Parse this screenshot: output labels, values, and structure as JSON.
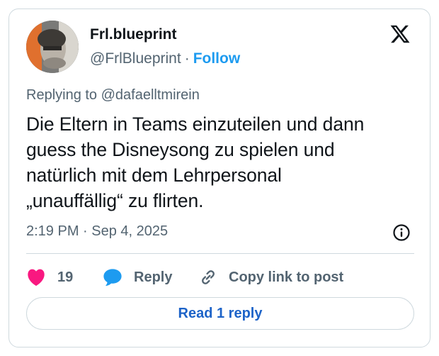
{
  "author": {
    "display_name": "Frl.blueprint",
    "handle": "@FrlBlueprint",
    "separator": "·",
    "follow_label": "Follow"
  },
  "tweet": {
    "replying_to": "Replying to @dafaelltmirein",
    "text_lines": [
      "Die Eltern in Teams einzuteilen und dann",
      "guess the Disneysong zu spielen und",
      "natürlich mit dem Lehrpersonal",
      "„unauffällig“ zu flirten."
    ],
    "timestamp": "2:19 PM · Sep 4, 2025"
  },
  "actions": {
    "like_count": "19",
    "reply_label": "Reply",
    "copy_link_label": "Copy link to post"
  },
  "footer": {
    "read_replies_label": "Read 1 reply"
  },
  "icons": {
    "brand": "x-logo-icon",
    "like": "heart-icon",
    "reply": "speech-bubble-icon",
    "copy": "link-icon",
    "info": "info-icon"
  },
  "colors": {
    "like": "#f91880",
    "reply": "#1d9bf0",
    "link": "#1d9bf0",
    "read_replies_text": "#1d63c8",
    "border": "#cfd9de"
  }
}
